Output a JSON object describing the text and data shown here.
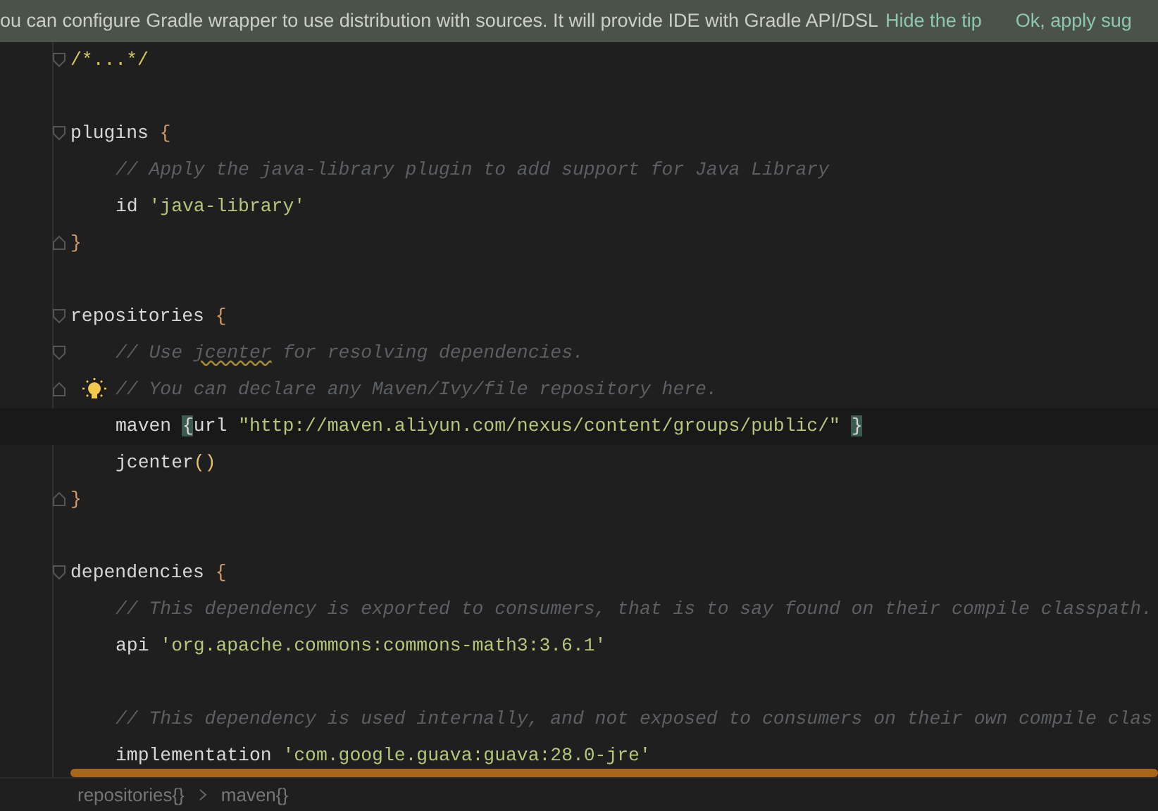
{
  "tip_banner": {
    "message": "ou can configure Gradle wrapper to use distribution with sources. It will provide IDE with Gradle API/DSL",
    "links": [
      "Hide the tip",
      "Ok, apply sug"
    ]
  },
  "editor": {
    "lines": [
      {
        "kind": "code",
        "fold_open": true,
        "tokens": [
          {
            "kind": "folded",
            "text": "/*...*/"
          }
        ]
      },
      {
        "kind": "blank"
      },
      {
        "kind": "code",
        "fold_open": true,
        "tokens": [
          {
            "kind": "plain",
            "text": "plugins "
          },
          {
            "kind": "brace",
            "text": "{"
          }
        ],
        "children": [
          {
            "kind": "code",
            "tokens": [
              {
                "kind": "comment",
                "text": "// Apply the java-library plugin to add support for Java Library"
              }
            ]
          },
          {
            "kind": "code",
            "tokens": [
              {
                "kind": "plain",
                "text": "id "
              },
              {
                "kind": "string",
                "text": "'java-library'"
              }
            ]
          }
        ]
      },
      {
        "kind": "code",
        "fold_close": true,
        "tokens": [
          {
            "kind": "brace",
            "text": "}"
          }
        ]
      },
      {
        "kind": "blank"
      },
      {
        "kind": "code",
        "fold_open": true,
        "tokens": [
          {
            "kind": "plain",
            "text": "repositories "
          },
          {
            "kind": "brace",
            "text": "{"
          }
        ],
        "children": [
          {
            "kind": "code",
            "fold_open": true,
            "tokens": [
              {
                "kind": "comment",
                "text": "// Use "
              },
              {
                "kind": "typo",
                "text": "jcenter"
              },
              {
                "kind": "comment",
                "text": " for resolving dependencies."
              }
            ]
          },
          {
            "kind": "code",
            "fold_close": true,
            "bulb": true,
            "tokens": [
              {
                "kind": "comment",
                "text": "// You can declare any Maven/Ivy/file repository here."
              }
            ]
          },
          {
            "kind": "code",
            "current": true,
            "tokens": [
              {
                "kind": "plain",
                "text": "maven "
              },
              {
                "kind": "matched",
                "text": "{"
              },
              {
                "kind": "plain",
                "text": "url "
              },
              {
                "kind": "string",
                "text": "\"http://maven.aliyun.com/nexus/content/groups/public/\" "
              },
              {
                "kind": "matched",
                "text": "}"
              }
            ]
          },
          {
            "kind": "code",
            "tokens": [
              {
                "kind": "plain",
                "text": "jcenter"
              },
              {
                "kind": "paren",
                "text": "()"
              }
            ]
          }
        ]
      },
      {
        "kind": "code",
        "fold_close": true,
        "tokens": [
          {
            "kind": "brace",
            "text": "}"
          }
        ]
      },
      {
        "kind": "blank"
      },
      {
        "kind": "code",
        "fold_open": true,
        "tokens": [
          {
            "kind": "plain",
            "text": "dependencies "
          },
          {
            "kind": "brace",
            "text": "{"
          }
        ],
        "children": [
          {
            "kind": "code",
            "tokens": [
              {
                "kind": "comment",
                "text": "// This dependency is exported to consumers, that is to say found on their compile classpath."
              }
            ]
          },
          {
            "kind": "code",
            "tokens": [
              {
                "kind": "plain",
                "text": "api "
              },
              {
                "kind": "string",
                "text": "'org.apache.commons:commons-math3:3.6.1'"
              }
            ]
          },
          {
            "kind": "blank"
          },
          {
            "kind": "code",
            "tokens": [
              {
                "kind": "comment",
                "text": "// This dependency is used internally, and not exposed to consumers on their own compile clas"
              }
            ]
          },
          {
            "kind": "code",
            "tokens": [
              {
                "kind": "plain",
                "text": "implementation "
              },
              {
                "kind": "string",
                "text": "'com.google.guava:guava:28.0-jre'"
              }
            ]
          }
        ]
      }
    ]
  },
  "breadcrumbs": [
    "repositories{}",
    "maven{}"
  ]
}
